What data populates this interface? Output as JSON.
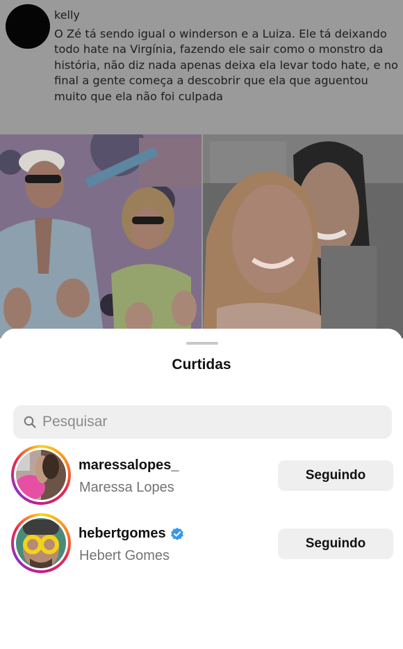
{
  "tweet": {
    "username": "kelly",
    "text": "O Zé tá sendo igual o winderson e a Luiza. Ele tá deixando todo hate na Virgínia, fazendo ele sair como o monstro da história, não diz nada apenas deixa ela levar todo hate, e no final a gente começa a descobrir que ela que aguentou muito que ela não foi culpada"
  },
  "likes_sheet": {
    "title": "Curtidas",
    "search": {
      "placeholder": "Pesquisar",
      "value": ""
    },
    "users": [
      {
        "username": "maressalopes_",
        "full_name": "Maressa Lopes",
        "verified": false,
        "button_label": "Seguindo"
      },
      {
        "username": "hebertgomes",
        "full_name": "Hebert Gomes",
        "verified": true,
        "button_label": "Seguindo"
      }
    ]
  },
  "colors": {
    "verified_badge": "#3797f0",
    "button_bg": "#efefef",
    "secondary_text": "#737373",
    "overlay_dim": "#9a9a9a"
  },
  "icons": {
    "search": "search-icon",
    "verified": "verified-badge-icon"
  }
}
